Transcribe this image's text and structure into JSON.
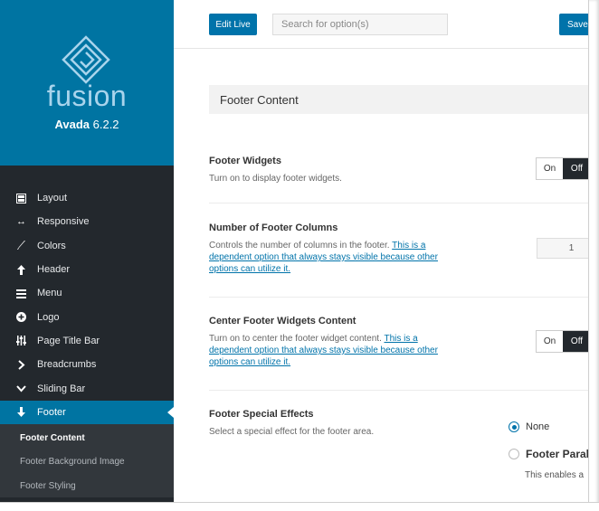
{
  "brand": {
    "logo_text": "fusion",
    "product": "Avada",
    "version": "6.2.2"
  },
  "sidebar": {
    "items": [
      {
        "label": "Layout",
        "icon": "layout-icon"
      },
      {
        "label": "Responsive",
        "icon": "arrows-horizontal-icon"
      },
      {
        "label": "Colors",
        "icon": "brush-icon"
      },
      {
        "label": "Header",
        "icon": "arrow-up-icon"
      },
      {
        "label": "Menu",
        "icon": "hamburger-icon"
      },
      {
        "label": "Logo",
        "icon": "plus-circle-icon"
      },
      {
        "label": "Page Title Bar",
        "icon": "sliders-icon"
      },
      {
        "label": "Breadcrumbs",
        "icon": "chevron-right-icon"
      },
      {
        "label": "Sliding Bar",
        "icon": "chevron-down-icon"
      },
      {
        "label": "Footer",
        "icon": "arrow-down-icon"
      }
    ],
    "sub_items": [
      {
        "label": "Footer Content"
      },
      {
        "label": "Footer Background Image"
      },
      {
        "label": "Footer Styling"
      }
    ]
  },
  "topbar": {
    "edit_live": "Edit Live",
    "search_placeholder": "Search for option(s)",
    "save": "Save"
  },
  "main": {
    "section_title": "Footer Content",
    "options": {
      "widgets": {
        "title": "Footer Widgets",
        "desc": "Turn on to display footer widgets.",
        "on": "On",
        "off": "Off"
      },
      "columns": {
        "title": "Number of Footer Columns",
        "desc": "Controls the number of columns in the footer.",
        "link": "This is a dependent option that always stays visible because other options can utilize it.",
        "value": "1"
      },
      "center": {
        "title": "Center Footer Widgets Content",
        "desc": "Turn on to center the footer widget content.",
        "link": "This is a dependent option that always stays visible because other options can utilize it.",
        "on": "On",
        "off": "Off"
      },
      "effects": {
        "title": "Footer Special Effects",
        "desc": "Select a special effect for the footer area.",
        "radio_none": "None",
        "radio_parallax": "Footer Parall",
        "parallax_desc": "This enables a"
      }
    }
  },
  "colors": {
    "accent": "#0073aa",
    "sidebar_bg": "#23282d",
    "brand_bg": "#0074a2"
  }
}
